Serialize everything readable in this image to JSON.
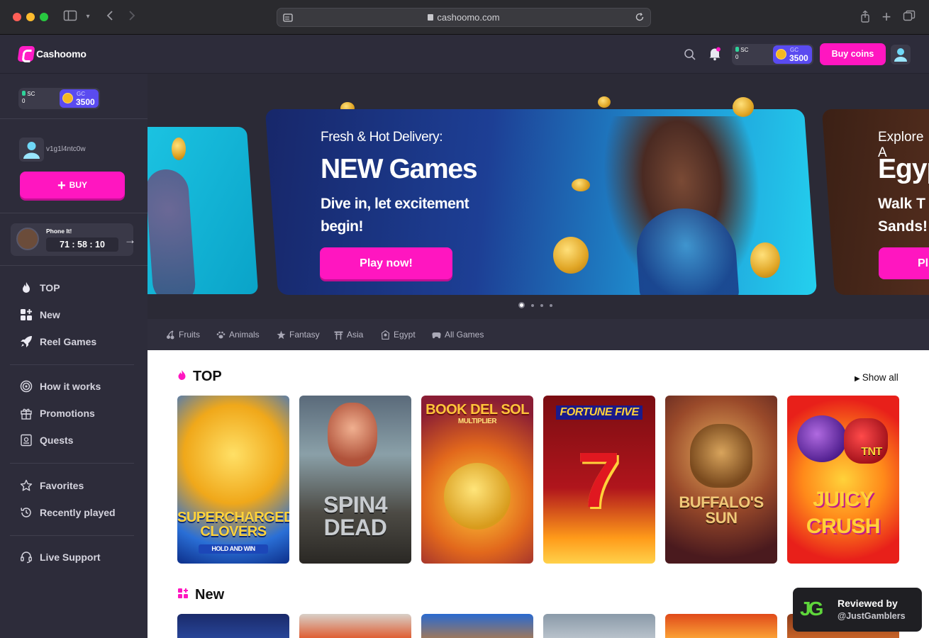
{
  "browser": {
    "url": "cashoomo.com"
  },
  "header": {
    "brand": "Cashoomo",
    "wallet": {
      "sc_label": "SC",
      "sc_value": "0",
      "gc_label": "GC",
      "gc_value": "3500"
    },
    "buy_coins_label": "Buy coins"
  },
  "sidebar": {
    "wallet": {
      "sc_label": "SC",
      "sc_value": "0",
      "gc_label": "GC",
      "gc_value": "3500"
    },
    "username": "v1g1l4ntc0w",
    "buy_label": "BUY",
    "promo": {
      "title": "Phone It!",
      "timer": "71 : 58 : 10"
    },
    "nav_group1": [
      {
        "label": "TOP",
        "icon": "flame-icon"
      },
      {
        "label": "New",
        "icon": "grid-plus-icon"
      },
      {
        "label": "Reel Games",
        "icon": "rocket-icon"
      }
    ],
    "nav_group2": [
      {
        "label": "How it works",
        "icon": "target-icon"
      },
      {
        "label": "Promotions",
        "icon": "gift-icon"
      },
      {
        "label": "Quests",
        "icon": "quest-icon"
      }
    ],
    "nav_group3": [
      {
        "label": "Favorites",
        "icon": "star-icon"
      },
      {
        "label": "Recently played",
        "icon": "history-icon"
      }
    ],
    "nav_group4": [
      {
        "label": "Live Support",
        "icon": "headset-icon"
      }
    ]
  },
  "banner": {
    "kicker": "Fresh & Hot Delivery:",
    "title": "NEW Games",
    "subtitle": "Dive in, let excitement begin!",
    "cta": "Play now!",
    "next_kicker": "Explore A",
    "next_title": "Egyp",
    "next_subtitle": "Walk T Sands!",
    "next_cta": "Pl",
    "slide_count": 4,
    "active_slide": 1
  },
  "categories": [
    {
      "label": "Fruits",
      "icon": "cherries-icon"
    },
    {
      "label": "Animals",
      "icon": "paw-icon"
    },
    {
      "label": "Fantasy",
      "icon": "star-icon"
    },
    {
      "label": "Asia",
      "icon": "torii-icon"
    },
    {
      "label": "Egypt",
      "icon": "pharaoh-icon"
    },
    {
      "label": "All Games",
      "icon": "gamepad-icon"
    }
  ],
  "top_section": {
    "title": "TOP",
    "show_all": "Show all",
    "games": [
      {
        "name": "SUPERCHARGED CLOVERS",
        "tagline": "HOLD AND WIN"
      },
      {
        "name": "SPIN4 DEAD",
        "tagline": ""
      },
      {
        "name": "BOOK DEL SOL",
        "tagline": "MULTIPLIER"
      },
      {
        "name": "FORTUNE FIVE",
        "tagline": ""
      },
      {
        "name": "BUFFALO'S SUN",
        "tagline": ""
      },
      {
        "name": "JUICY CRUSH",
        "tagline": "TNT"
      }
    ]
  },
  "new_section": {
    "title": "New"
  },
  "review_badge": {
    "line1": "Reviewed by",
    "line2": "@JustGamblers"
  },
  "colors": {
    "accent": "#ff16c0",
    "sidebar_bg": "#2d2c3a",
    "gc_badge": "#5a4bf0"
  }
}
